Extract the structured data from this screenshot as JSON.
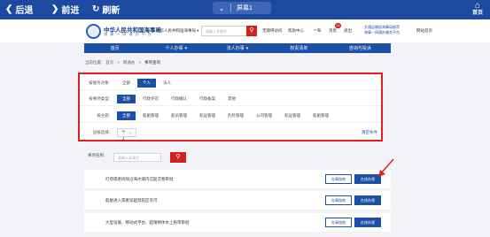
{
  "appbar": {
    "back_label": "后退",
    "forward_label": "前进",
    "refresh_label": "刷新",
    "tab_title": "屏幕1",
    "home_label": "首页"
  },
  "header": {
    "site_title": "中华人民共和国海事局",
    "site_subtitle": "海 事 一 网 通 办 平 台",
    "location": "中华人民共和国海事局",
    "search_placeholder": "请输入关键字",
    "links": [
      "无障碍访问",
      "帮助中心",
      "**海",
      "消息",
      "退出"
    ],
    "badge_count": "18",
    "notice_lines": [
      "交通运输部海事局推荐",
      "海事一网通办服务平台",
      "网站首页"
    ]
  },
  "menu": [
    "首页",
    "个人办事",
    "法人办事",
    "权责清单",
    "咨询与投诉"
  ],
  "breadcrumbs": [
    "当前位置:",
    "首页",
    "网通办",
    "事项查询"
  ],
  "filters": {
    "service_object": {
      "label": "按服务对象:",
      "options": [
        "全部",
        "个人",
        "法人"
      ],
      "selected": 1
    },
    "item_type": {
      "label": "按事项类型:",
      "options": [
        "全部",
        "行政许可",
        "行政确认",
        "行政备案",
        "其他"
      ],
      "selected": 0
    },
    "theme": {
      "label": "按主题:",
      "options": [
        "全部",
        "船舶管理",
        "船员管理",
        "航运管理",
        "危险管理",
        "公司管理",
        "航运管理",
        "船舶管理"
      ],
      "selected": 0
    },
    "level": {
      "label": "层级选择:",
      "value": "个人"
    },
    "clear_label": "清空条件"
  },
  "results": {
    "search_label": "事项名称:",
    "search_placeholder": "请输入关键字",
    "items": [
      {
        "title": "打捞或者拆除沿海水域内沉船沉物审批",
        "btn_guide": "办事指南",
        "btn_apply": "在线办理"
      },
      {
        "title": "船舶进入或者穿越禁航区许可",
        "btn_guide": "办事指南",
        "btn_apply": "在线办理"
      },
      {
        "title": "大型设施、移动式平台、超限物体水上拖带审批",
        "btn_guide": "办事指南",
        "btn_apply": "在线办理"
      }
    ]
  },
  "colors": {
    "appbar": "#1b4aa0",
    "menu": "#1c4fa6",
    "highlight_border": "#e02020",
    "search_button": "#d32020"
  }
}
